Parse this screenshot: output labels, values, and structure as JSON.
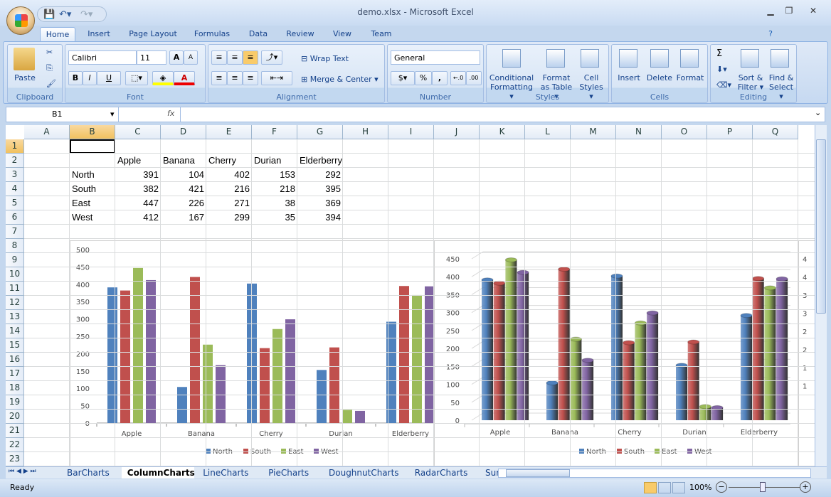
{
  "window": {
    "title": "demo.xlsx - Microsoft Excel",
    "minimize": "▁",
    "restore": "❐",
    "close": "✕"
  },
  "ribbon_tabs": [
    "Home",
    "Insert",
    "Page Layout",
    "Formulas",
    "Data",
    "Review",
    "View",
    "Team"
  ],
  "ribbon": {
    "clipboard": {
      "label": "Clipboard",
      "paste": "Paste"
    },
    "font": {
      "label": "Font",
      "name": "Calibri",
      "size": "11",
      "bold": "B",
      "italic": "I",
      "underline": "U",
      "grow": "A",
      "shrink": "A",
      "color": "A"
    },
    "alignment": {
      "label": "Alignment",
      "wrap": "Wrap Text",
      "merge": "Merge & Center"
    },
    "number": {
      "label": "Number",
      "format": "General",
      "percent": "%",
      "comma": ",",
      "inc": "←.0",
      "dec": ".00"
    },
    "styles": {
      "label": "Styles",
      "conditional": "Conditional",
      "conditional2": "Formatting ▾",
      "table": "Format",
      "table2": "as Table ▾",
      "cell": "Cell",
      "cell2": "Styles ▾"
    },
    "cells": {
      "label": "Cells",
      "insert": "Insert",
      "delete": "Delete",
      "format": "Format"
    },
    "editing": {
      "label": "Editing",
      "sum": "Σ",
      "sort": "Sort &",
      "sort2": "Filter ▾",
      "find": "Find &",
      "find2": "Select ▾"
    }
  },
  "formula_bar": {
    "name_box": "B1",
    "fx": "fx",
    "value": ""
  },
  "columns": [
    "A",
    "B",
    "C",
    "D",
    "E",
    "F",
    "G",
    "H",
    "I",
    "J",
    "K",
    "L",
    "M",
    "N",
    "O",
    "P",
    "Q"
  ],
  "selected_column": "B",
  "selected_row": "1",
  "rows": [
    "1",
    "2",
    "3",
    "4",
    "5",
    "6",
    "7",
    "8",
    "9",
    "10",
    "11",
    "12",
    "13",
    "14",
    "15",
    "16",
    "17",
    "18",
    "19",
    "20",
    "21",
    "22",
    "23"
  ],
  "table": {
    "headers": [
      "Apple",
      "Banana",
      "Cherry",
      "Durian",
      "Elderberry"
    ],
    "rows": [
      {
        "label": "North",
        "values": [
          391,
          104,
          402,
          153,
          292
        ]
      },
      {
        "label": "South",
        "values": [
          382,
          421,
          216,
          218,
          395
        ]
      },
      {
        "label": "East",
        "values": [
          447,
          226,
          271,
          38,
          369
        ]
      },
      {
        "label": "West",
        "values": [
          412,
          167,
          299,
          35,
          394
        ]
      }
    ]
  },
  "chart_data": [
    {
      "type": "bar",
      "style": "clustered column",
      "categories": [
        "Apple",
        "Banana",
        "Cherry",
        "Durian",
        "Elderberry"
      ],
      "series": [
        {
          "name": "North",
          "values": [
            391,
            104,
            402,
            153,
            292
          ]
        },
        {
          "name": "South",
          "values": [
            382,
            421,
            216,
            218,
            395
          ]
        },
        {
          "name": "East",
          "values": [
            447,
            226,
            271,
            38,
            369
          ]
        },
        {
          "name": "West",
          "values": [
            412,
            167,
            299,
            35,
            394
          ]
        }
      ],
      "ylim": [
        0,
        500
      ],
      "yticks": [
        0,
        50,
        100,
        150,
        200,
        250,
        300,
        350,
        400,
        450,
        500
      ],
      "grid": false,
      "legend": "bottom"
    },
    {
      "type": "bar",
      "style": "3-D clustered cylinder",
      "categories": [
        "Apple",
        "Banana",
        "Cherry",
        "Durian",
        "Elderberry"
      ],
      "series": [
        {
          "name": "North",
          "values": [
            391,
            104,
            402,
            153,
            292
          ]
        },
        {
          "name": "South",
          "values": [
            382,
            421,
            216,
            218,
            395
          ]
        },
        {
          "name": "East",
          "values": [
            447,
            226,
            271,
            38,
            369
          ]
        },
        {
          "name": "West",
          "values": [
            412,
            167,
            299,
            35,
            394
          ]
        }
      ],
      "ylim": [
        0,
        450
      ],
      "yticks": [
        0,
        50,
        100,
        150,
        200,
        250,
        300,
        350,
        400,
        450
      ],
      "grid": true,
      "legend": "bottom"
    }
  ],
  "partial_chart_ticks": [
    "4",
    "4",
    "3",
    "3",
    "2",
    "2",
    "1",
    "1"
  ],
  "colors": {
    "North": "#4f81bd",
    "South": "#c0504d",
    "East": "#9bbb59",
    "West": "#8064a2"
  },
  "sheet_tabs": [
    "BarCharts",
    "ColumnCharts",
    "LineCharts",
    "PieCharts",
    "DoughnutCharts",
    "RadarCharts",
    "SurfaceCh"
  ],
  "active_sheet": "ColumnCharts",
  "status": {
    "text": "Ready",
    "zoom": "100%"
  }
}
